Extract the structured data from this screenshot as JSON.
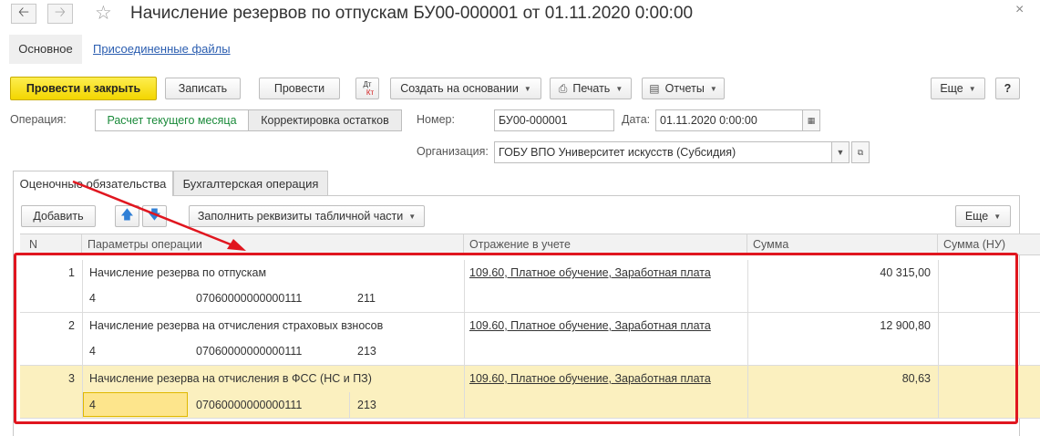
{
  "window": {
    "title": "Начисление резервов по отпускам БУ00-000001 от 01.11.2020 0:00:00"
  },
  "icons": {
    "back": "arrow-left-icon",
    "forward": "arrow-right-icon",
    "favorite": "star-icon",
    "close": "close-icon"
  },
  "section_tabs": {
    "main": "Основное",
    "files": "Присоединенные файлы"
  },
  "toolbar": {
    "post_close": "Провести и закрыть",
    "save": "Записать",
    "post": "Провести",
    "dtkt_dt": "Дт",
    "dtkt_kt": "Кт",
    "create_based": "Создать на основании",
    "print": "Печать",
    "reports": "Отчеты",
    "more": "Еще",
    "help": "?"
  },
  "form": {
    "operation_label": "Операция:",
    "operation_options": [
      "Расчет текущего месяца",
      "Корректировка остатков"
    ],
    "number_label": "Номер:",
    "number_value": "БУ00-000001",
    "date_label": "Дата:",
    "date_value": "01.11.2020  0:00:00",
    "org_label": "Организация:",
    "org_value": "ГОБУ ВПО Университет искусств (Субсидия)"
  },
  "page_tabs": [
    "Оценочные обязательства",
    "Бухгалтерская операция"
  ],
  "table_toolbar": {
    "add": "Добавить",
    "fill": "Заполнить реквизиты табличной части",
    "more": "Еще"
  },
  "table": {
    "columns": [
      "N",
      "Параметры операции",
      "Отражение в учете",
      "Сумма",
      "Сумма (НУ)"
    ],
    "rows": [
      {
        "n": "1",
        "name": "Начисление резерва по отпускам",
        "code1": "4",
        "code2": "07060000000000111",
        "code3": "211",
        "account": "109.60, Платное обучение, Заработная плата",
        "sum": "40 315,00"
      },
      {
        "n": "2",
        "name": "Начисление резерва на отчисления страховых взносов",
        "code1": "4",
        "code2": "07060000000000111",
        "code3": "213",
        "account": "109.60, Платное обучение, Заработная плата",
        "sum": "12 900,80"
      },
      {
        "n": "3",
        "name": "Начисление резерва на отчисления в ФСС (НС и ПЗ)",
        "code1": "4",
        "code2": "07060000000000111",
        "code3": "213",
        "account": "109.60, Платное обучение, Заработная плата",
        "sum": "80,63"
      }
    ]
  },
  "colors": {
    "primary_button": "#f3d600",
    "selected_row": "#fbf0bf",
    "annotation": "#e0161f",
    "link": "#2a5db0",
    "active_option": "#1a8a3a"
  }
}
